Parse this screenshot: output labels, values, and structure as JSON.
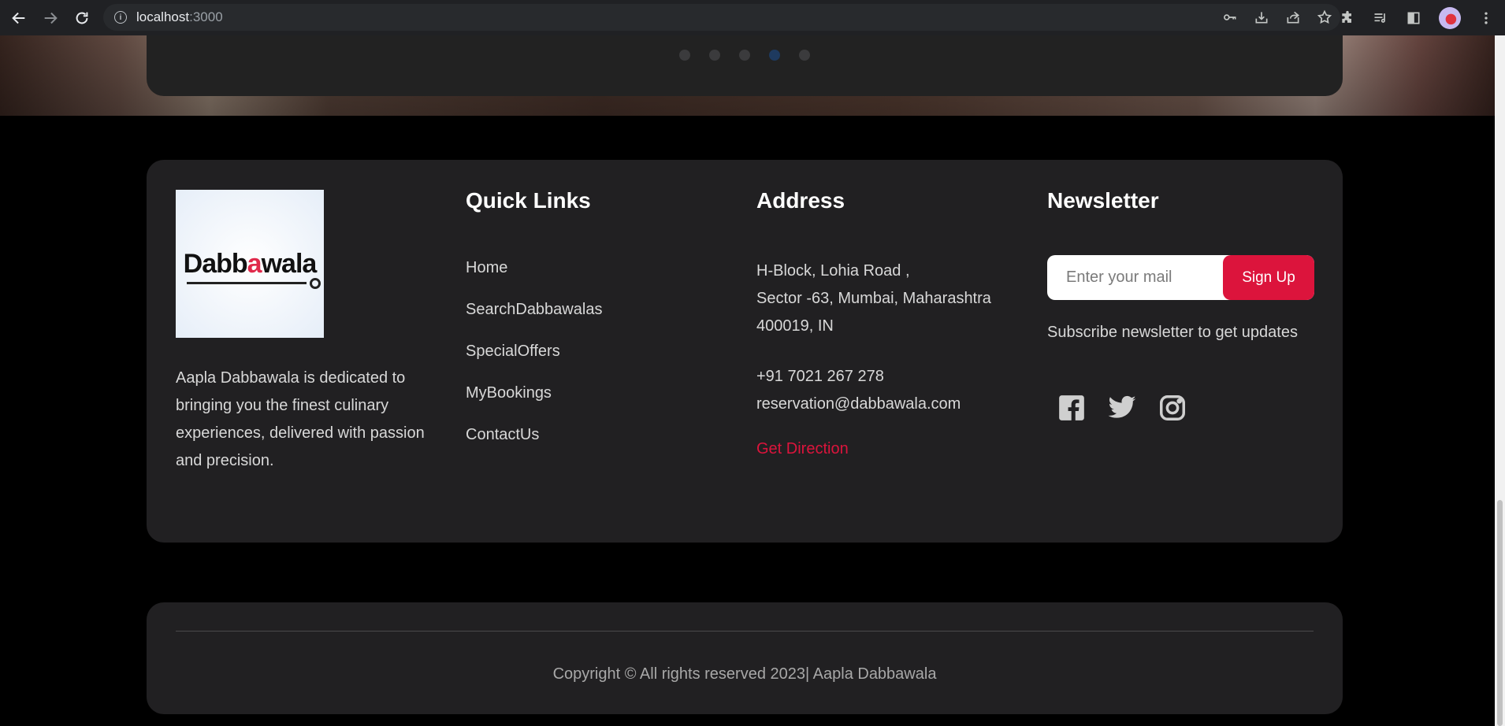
{
  "browser": {
    "url_host": "localhost",
    "url_port": ":3000",
    "icons": [
      "back-icon",
      "forward-icon",
      "reload-icon",
      "site-info-icon",
      "key-icon",
      "install-icon",
      "share-icon",
      "bookmark-star-icon",
      "extensions-icon",
      "reading-list-icon",
      "side-panel-icon",
      "profile-avatar",
      "menu-icon"
    ]
  },
  "carousel": {
    "dots": 5,
    "active_index": 3
  },
  "footer": {
    "logo_text_1": "Dabb",
    "logo_text_2": "a",
    "logo_text_3": "wala",
    "about": "Aapla Dabbawala is dedicated to bringing you the finest culinary experiences, delivered with passion and precision.",
    "quick_links": {
      "title": "Quick Links",
      "items": [
        "Home",
        "SearchDabbawalas",
        "SpecialOffers",
        "MyBookings",
        "ContactUs"
      ]
    },
    "address": {
      "title": "Address",
      "line1": "H-Block, Lohia Road ,",
      "line2": "Sector -63, Mumbai, Maharashtra",
      "line3": "400019, IN",
      "phone": "+91 7021 267 278",
      "email": "reservation@dabbawala.com",
      "direction": "Get Direction"
    },
    "newsletter": {
      "title": "Newsletter",
      "placeholder": "Enter your mail",
      "button": "Sign Up",
      "subtitle": "Subscribe newsletter to get updates",
      "social": [
        "facebook-icon",
        "twitter-icon",
        "instagram-icon"
      ]
    }
  },
  "copyright": "Copyright © All rights reserved 2023| Aapla Dabbawala",
  "colors": {
    "accent": "#dc143c",
    "card": "#212022",
    "background": "#000000"
  }
}
